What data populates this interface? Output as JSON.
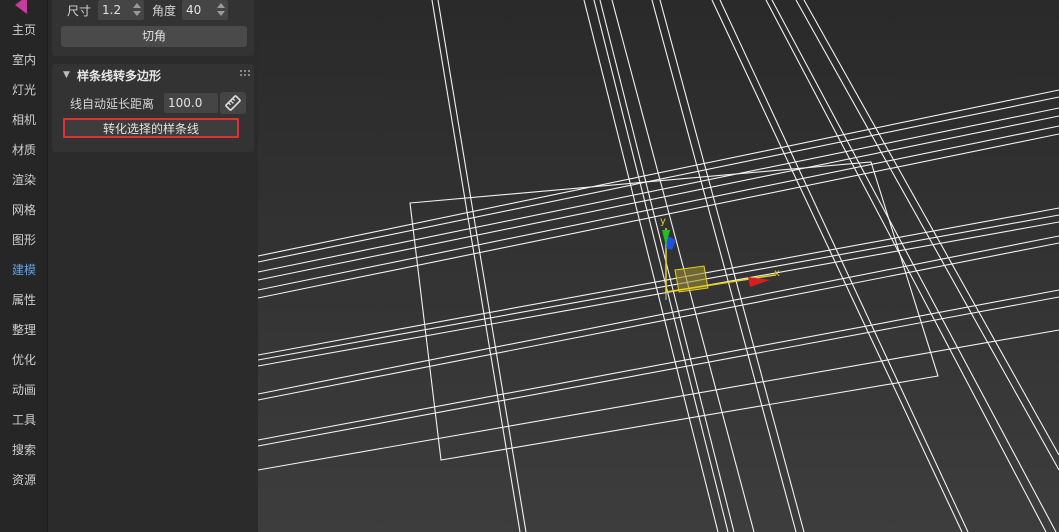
{
  "nav": {
    "items": [
      "主页",
      "室内",
      "灯光",
      "相机",
      "材质",
      "渲染",
      "网格",
      "图形",
      "建模",
      "属性",
      "整理",
      "优化",
      "动画",
      "工具",
      "搜索",
      "资源"
    ],
    "active": "建模",
    "active_color": "#5fa0e8",
    "logo_color": "#c43c9c"
  },
  "chamfer": {
    "size_label": "尺寸",
    "size_value": "1.2",
    "angle_label": "角度",
    "angle_value": "40",
    "button": "切角"
  },
  "spline_section": {
    "title": "样条线转多边形",
    "extend_label": "线自动延长距离",
    "extend_value": "100.0",
    "convert_button": "转化选择的样条线",
    "highlight_color": "#e03030"
  },
  "viewport": {
    "gizmo_y": "y",
    "gizmo_x": "x",
    "axis_colors": {
      "x": "#d42020",
      "y": "#20c020",
      "z": "#2050e0",
      "highlight": "#e8d020"
    }
  }
}
